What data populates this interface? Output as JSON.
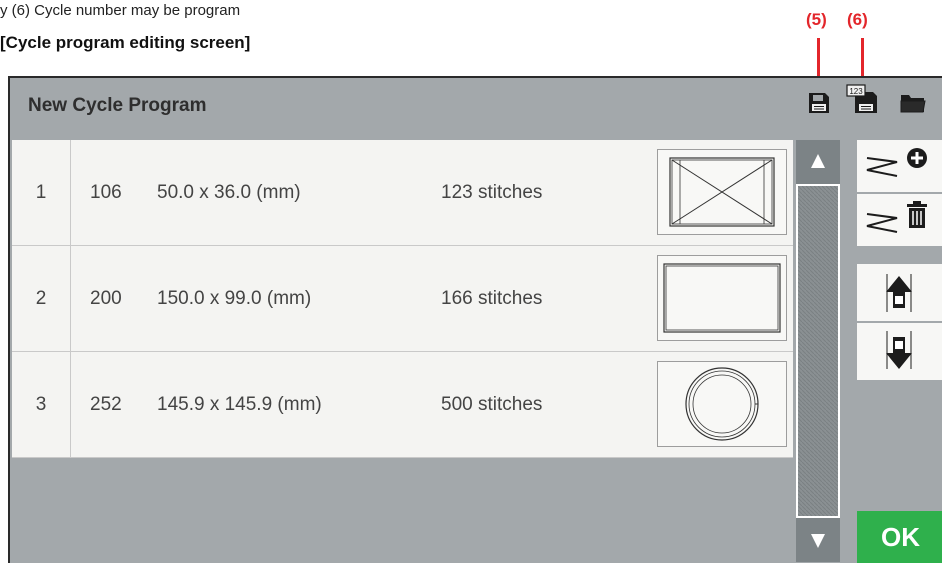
{
  "doc": {
    "top_text": "y (6) Cycle number may be program",
    "heading": "[Cycle program editing screen]",
    "callout_5": "(5)",
    "callout_6": "(6)"
  },
  "screen": {
    "title": "New Cycle Program",
    "toolbar": [
      {
        "name": "save-icon"
      },
      {
        "name": "save-as-number-icon",
        "badge": "123"
      },
      {
        "name": "open-folder-icon"
      }
    ],
    "rows": [
      {
        "index": "1",
        "program": "106",
        "size": "50.0 x 36.0 (mm)",
        "stitches": "123 stitches",
        "thumbnail": "rectangle-cross-pattern"
      },
      {
        "index": "2",
        "program": "200",
        "size": "150.0 x 99.0 (mm)",
        "stitches": "166 stitches",
        "thumbnail": "rectangle-pattern"
      },
      {
        "index": "3",
        "program": "252",
        "size": "145.9 x 145.9 (mm)",
        "stitches": "500 stitches",
        "thumbnail": "circle-pattern"
      }
    ],
    "scroll": {
      "up_icon": "triangle-up-icon",
      "down_icon": "triangle-down-icon"
    },
    "side_buttons": [
      {
        "name": "add-program-icon"
      },
      {
        "name": "delete-program-icon"
      },
      {
        "name": "move-up-icon"
      },
      {
        "name": "move-down-icon"
      }
    ],
    "ok_label": "OK",
    "colors": {
      "screen_bg": "#a3a8ab",
      "ok_green": "#2fb04c",
      "callout_red": "#e3262b"
    }
  }
}
